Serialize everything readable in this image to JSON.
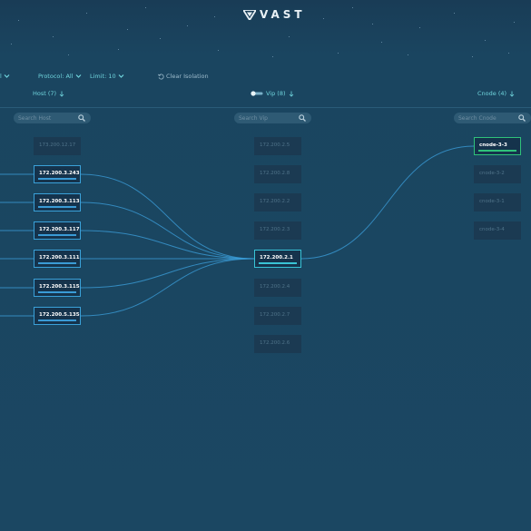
{
  "brand": {
    "name": "VAST"
  },
  "filters": {
    "first_value": "l",
    "protocol_label": "Protocol: All",
    "limit_label": "Limit: 10",
    "clear_isolation_label": "Clear Isolation"
  },
  "columns": {
    "host": {
      "header": "Host (7)",
      "search_placeholder": "Search Host",
      "nodes": [
        {
          "label": "173.200.12.17",
          "active": false
        },
        {
          "label": "172.200.3.243",
          "active": true
        },
        {
          "label": "172.200.3.113",
          "active": true
        },
        {
          "label": "172.200.3.117",
          "active": true
        },
        {
          "label": "172.200.3.111",
          "active": true
        },
        {
          "label": "172.200.3.115",
          "active": true
        },
        {
          "label": "172.200.5.135",
          "active": true
        }
      ]
    },
    "vip": {
      "header": "Vip (8)",
      "search_placeholder": "Search Vip",
      "nodes": [
        {
          "label": "172.200.2.5",
          "active": false
        },
        {
          "label": "172.200.2.8",
          "active": false
        },
        {
          "label": "172.200.2.2",
          "active": false
        },
        {
          "label": "172.200.2.3",
          "active": false
        },
        {
          "label": "172.200.2.1",
          "active": true
        },
        {
          "label": "172.200.2.4",
          "active": false
        },
        {
          "label": "172.200.2.7",
          "active": false
        },
        {
          "label": "172.200.2.6",
          "active": false
        }
      ]
    },
    "cnode": {
      "header": "Cnode (4)",
      "search_placeholder": "Search Cnode",
      "nodes": [
        {
          "label": "cnode-3-3",
          "active": true
        },
        {
          "label": "cnode-3-2",
          "active": false
        },
        {
          "label": "cnode-3-1",
          "active": false
        },
        {
          "label": "cnode-3-4",
          "active": false
        }
      ]
    }
  },
  "colors": {
    "background": "#1a4660",
    "accent": "#6fd4dc",
    "link": "#3a9bd6",
    "cnode_selected": "#2fc27a"
  }
}
